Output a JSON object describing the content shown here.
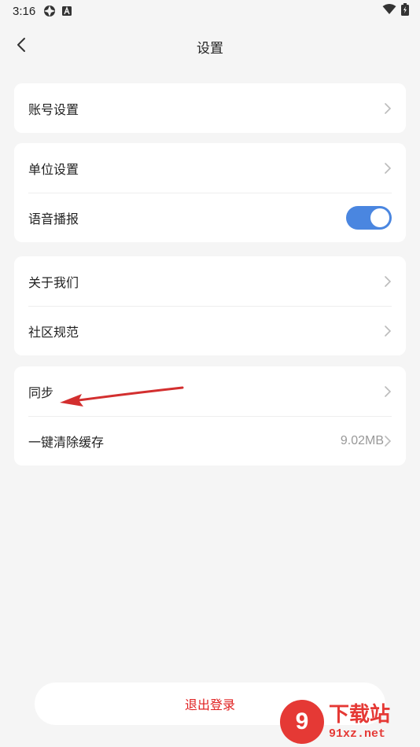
{
  "status_bar": {
    "time": "3:16",
    "icons": [
      "gear-like-icon",
      "font-a-icon",
      "wifi-icon",
      "battery-icon"
    ]
  },
  "header": {
    "title": "设置",
    "back_icon": "chevron-left-icon"
  },
  "groups": [
    {
      "items": [
        {
          "label": "账号设置",
          "type": "link"
        }
      ]
    },
    {
      "items": [
        {
          "label": "单位设置",
          "type": "link"
        },
        {
          "label": "语音播报",
          "type": "toggle",
          "on": true
        }
      ]
    },
    {
      "items": [
        {
          "label": "关于我们",
          "type": "link"
        },
        {
          "label": "社区规范",
          "type": "link"
        }
      ]
    },
    {
      "items": [
        {
          "label": "同步",
          "type": "link"
        },
        {
          "label": "一键清除缓存",
          "type": "link",
          "value": "9.02MB"
        }
      ]
    }
  ],
  "logout": {
    "label": "退出登录"
  },
  "colors": {
    "accent": "#4a86e0",
    "danger": "#e02020",
    "background": "#f5f5f5",
    "annotation_arrow": "#d32f2f"
  },
  "watermark": {
    "badge": "9",
    "title": "下载站",
    "url": "91xz.net"
  }
}
